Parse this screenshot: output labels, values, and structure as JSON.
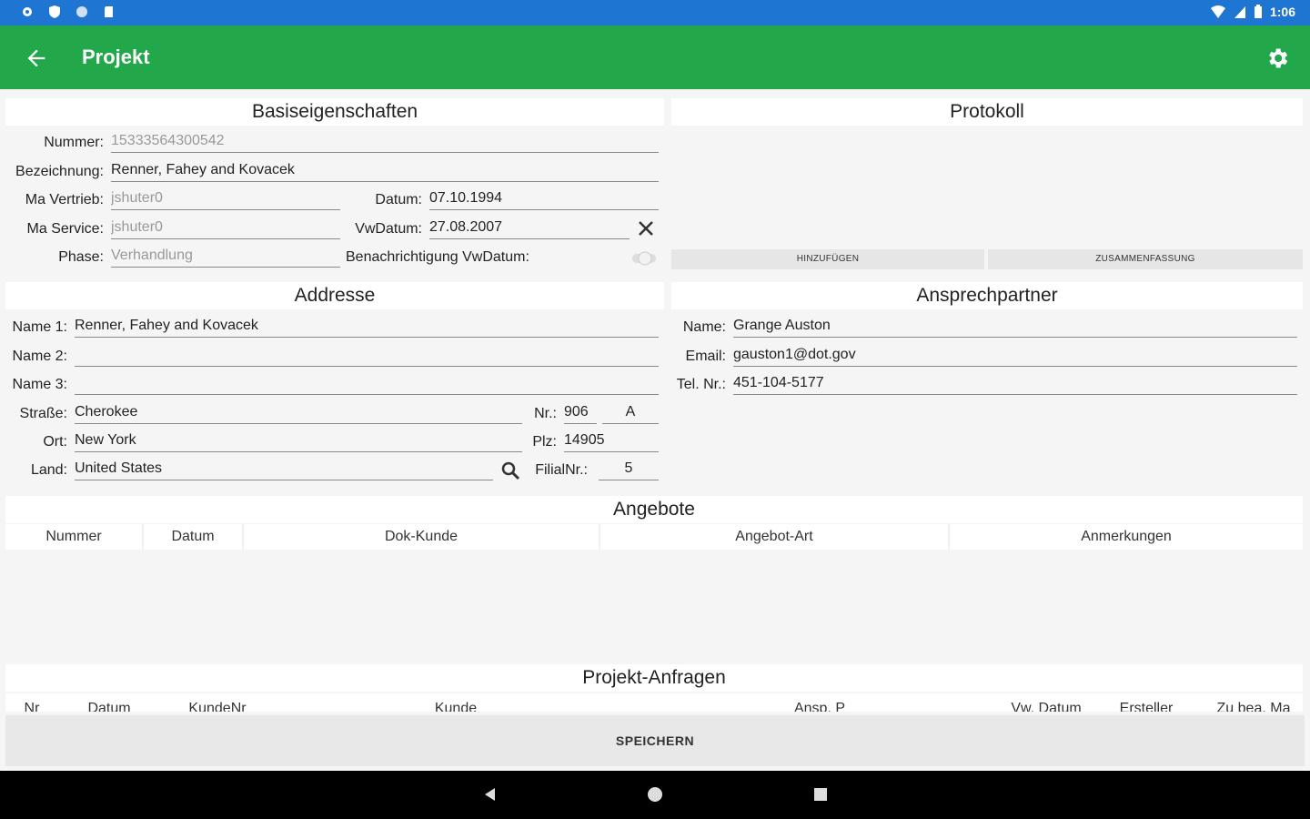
{
  "statusbar": {
    "time": "1:06"
  },
  "appbar": {
    "title": "Projekt"
  },
  "basis": {
    "heading": "Basiseigenschaften",
    "nummer_label": "Nummer:",
    "nummer_value": "15333564300542",
    "bezeichnung_label": "Bezeichnung:",
    "bezeichnung_value": "Renner, Fahey and Kovacek",
    "ma_vertrieb_label": "Ma Vertrieb:",
    "ma_vertrieb_value": "jshuter0",
    "datum_label": "Datum:",
    "datum_value": "07.10.1994",
    "ma_service_label": "Ma Service:",
    "ma_service_value": "jshuter0",
    "vwdatum_label": "VwDatum:",
    "vwdatum_value": "27.08.2007",
    "phase_label": "Phase:",
    "phase_value": "Verhandlung",
    "benachrichtigung_label": "Benachrichtigung VwDatum:"
  },
  "protokoll": {
    "heading": "Protokoll",
    "add_button": "HINZUFÜGEN",
    "summary_button": "ZUSAMMENFASSUNG"
  },
  "adresse": {
    "heading": "Addresse",
    "name1_label": "Name 1:",
    "name1_value": "Renner, Fahey and Kovacek",
    "name2_label": "Name 2:",
    "name2_value": "",
    "name3_label": "Name 3:",
    "name3_value": "",
    "strasse_label": "Straße:",
    "strasse_value": "Cherokee",
    "nr_label": "Nr.:",
    "nr_value": "906",
    "nr_suffix": "A",
    "ort_label": "Ort:",
    "ort_value": "New York",
    "plz_label": "Plz:",
    "plz_value": "14905",
    "land_label": "Land:",
    "land_value": "United States",
    "filialnr_label": "FilialNr.:",
    "filialnr_value": "5"
  },
  "ansprechpartner": {
    "heading": "Ansprechpartner",
    "name_label": "Name:",
    "name_value": "Grange Auston",
    "email_label": "Email:",
    "email_value": "gauston1@dot.gov",
    "tel_label": "Tel. Nr.:",
    "tel_value": "451-104-5177"
  },
  "angebote": {
    "heading": "Angebote",
    "columns": [
      "Nummer",
      "Datum",
      "Dok-Kunde",
      "Angebot-Art",
      "Anmerkungen"
    ]
  },
  "anfragen": {
    "heading": "Projekt-Anfragen",
    "columns": [
      "Nr",
      "Datum",
      "KundeNr",
      "Kunde",
      "Ansp. P",
      "Vw. Datum",
      "Ersteller",
      "Zu bea. Ma"
    ]
  },
  "save_button": "SPEICHERN"
}
